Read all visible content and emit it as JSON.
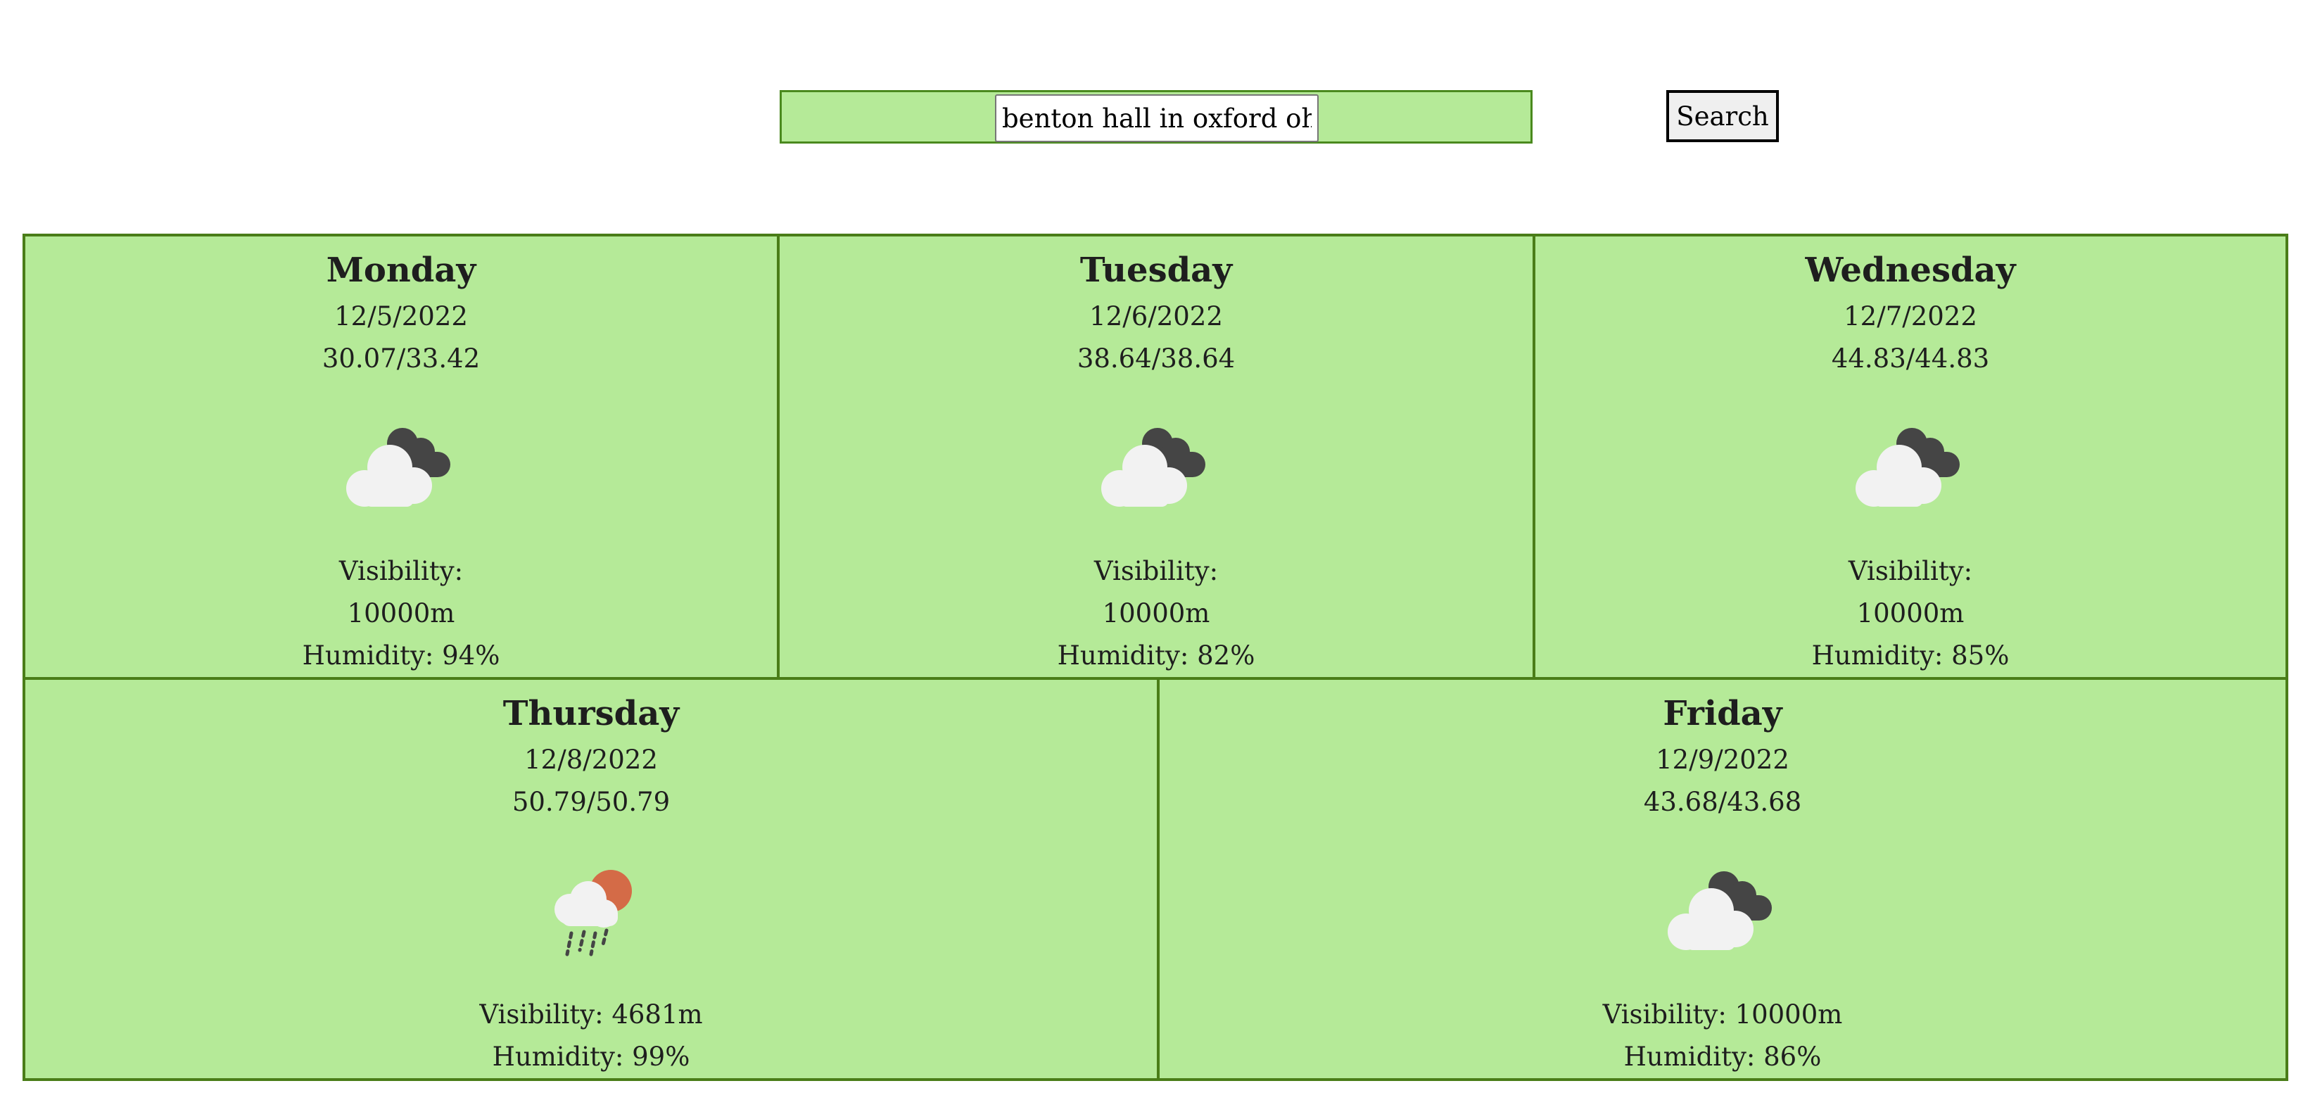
{
  "search": {
    "value": "benton hall in oxford ohi",
    "button_label": "Search"
  },
  "colors": {
    "card_background": "#b5ea98",
    "card_border": "#4a7d18",
    "dark_cloud": "#454545",
    "light_cloud": "#f2f2f2",
    "sun": "#d46b47"
  },
  "forecast": [
    {
      "day": "Monday",
      "date": "12/5/2022",
      "temp": "30.07/33.42",
      "icon": "cloudy-icon",
      "visibility_label": "Visibility:",
      "visibility_value": "10000m",
      "humidity": "Humidity: 94%"
    },
    {
      "day": "Tuesday",
      "date": "12/6/2022",
      "temp": "38.64/38.64",
      "icon": "cloudy-icon",
      "visibility_label": "Visibility:",
      "visibility_value": "10000m",
      "humidity": "Humidity: 82%"
    },
    {
      "day": "Wednesday",
      "date": "12/7/2022",
      "temp": "44.83/44.83",
      "icon": "cloudy-icon",
      "visibility_label": "Visibility:",
      "visibility_value": "10000m",
      "humidity": "Humidity: 85%"
    },
    {
      "day": "Thursday",
      "date": "12/8/2022",
      "temp": "50.79/50.79",
      "icon": "rain-sun-icon",
      "visibility": "Visibility: 4681m",
      "humidity": "Humidity: 99%"
    },
    {
      "day": "Friday",
      "date": "12/9/2022",
      "temp": "43.68/43.68",
      "icon": "cloudy-icon",
      "visibility": "Visibility: 10000m",
      "humidity": "Humidity: 86%"
    }
  ]
}
